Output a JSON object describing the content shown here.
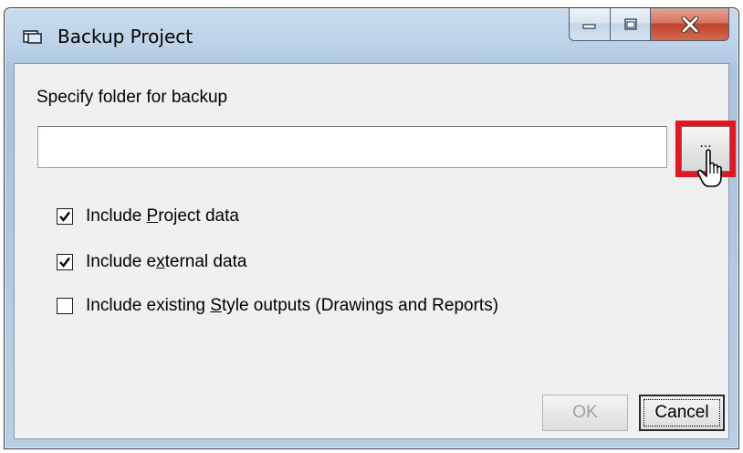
{
  "window": {
    "title": "Backup Project",
    "controls": {
      "minimize": "minimize",
      "maximize": "maximize",
      "close": "close"
    }
  },
  "form": {
    "folder_label": "Specify folder for backup",
    "folder_value": "",
    "browse_label": "...",
    "options": [
      {
        "before": "Include ",
        "accel": "P",
        "after": "roject data",
        "checked": true
      },
      {
        "before": "Include e",
        "accel": "x",
        "after": "ternal data",
        "checked": true
      },
      {
        "before": "Include existing ",
        "accel": "S",
        "after": "tyle outputs (Drawings and Reports)",
        "checked": false
      }
    ]
  },
  "buttons": {
    "ok": "OK",
    "cancel": "Cancel"
  },
  "colors": {
    "highlight": "#e8141e",
    "close_button": "#c0432a"
  }
}
